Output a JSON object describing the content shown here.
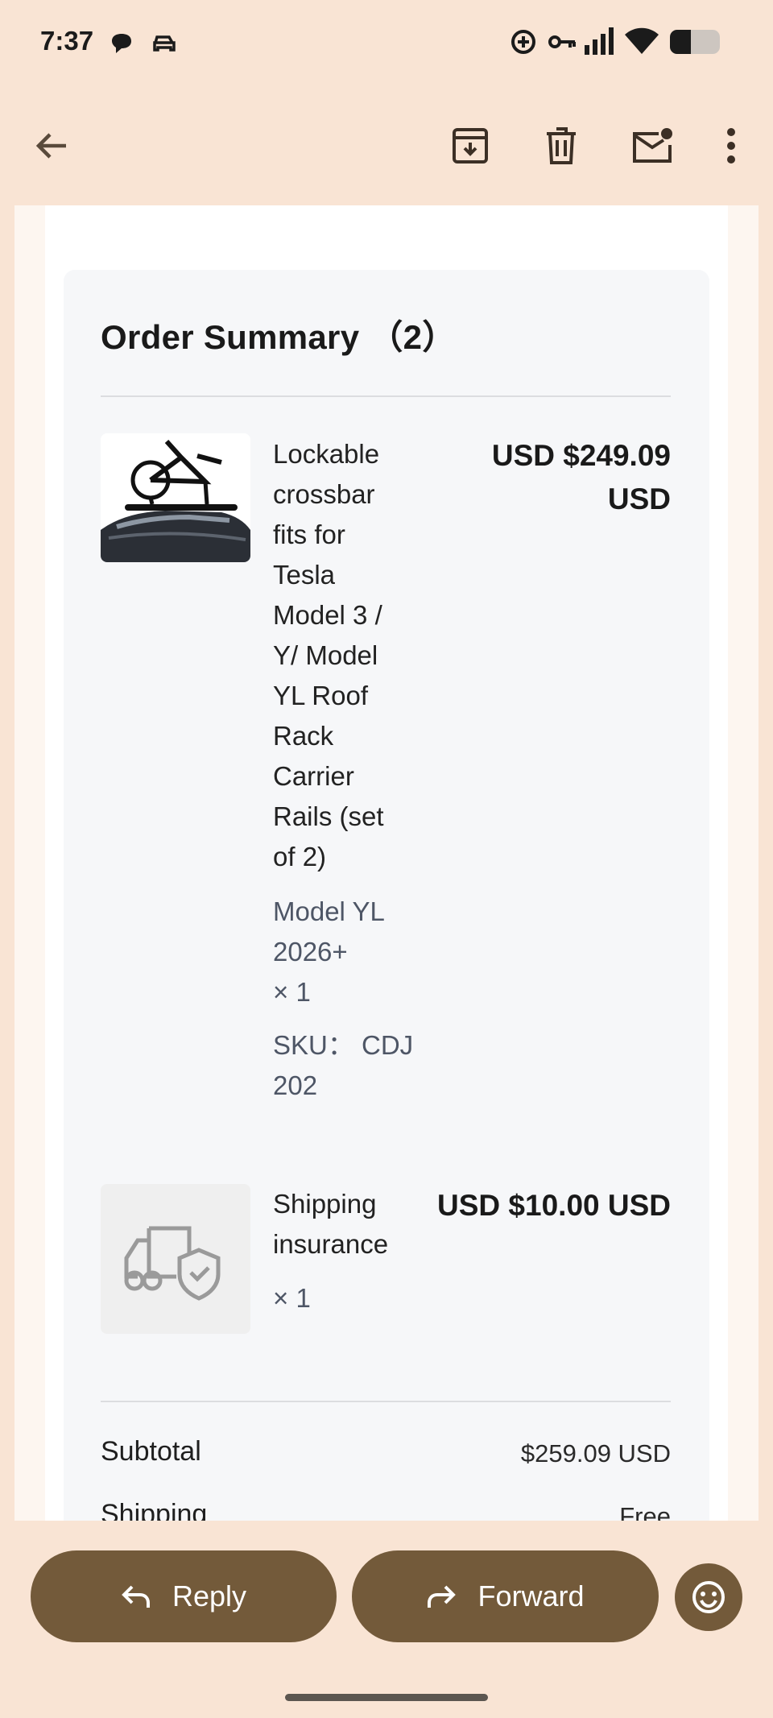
{
  "status_bar": {
    "time": "7:37",
    "icons": [
      "chat-bubble-icon",
      "car-icon",
      "data-saver-icon",
      "vpn-key-icon",
      "signal-icon",
      "wifi-icon",
      "battery-icon"
    ]
  },
  "toolbar": {
    "back_icon": "arrow-back-icon",
    "actions": [
      "archive-icon",
      "delete-icon",
      "mark-unread-icon",
      "more-vert-icon"
    ]
  },
  "order": {
    "title": "Order Summary （2）",
    "items": [
      {
        "name": "Lockable crossbar fits for Tesla Model 3 / Y/ Model YL Roof Rack Carrier Rails (set of 2)",
        "variant": "Model YL 2026+",
        "qty": "× 1",
        "sku": "SKU： CDJ 202",
        "price": "USD $249.09 USD"
      },
      {
        "name": "Shipping insurance",
        "qty": "× 1",
        "price": "USD $10.00 USD"
      }
    ],
    "subtotal_label": "Subtotal",
    "subtotal_value": "$259.09 USD",
    "shipping_label": "Shipping",
    "shipping_value": "Free"
  },
  "actions": {
    "reply_label": "Reply",
    "forward_label": "Forward",
    "emoji_icon": "emoji-smile-icon"
  },
  "colors": {
    "background": "#f9e4d4",
    "card": "#f6f7f9",
    "accent_button": "#735a3a"
  }
}
